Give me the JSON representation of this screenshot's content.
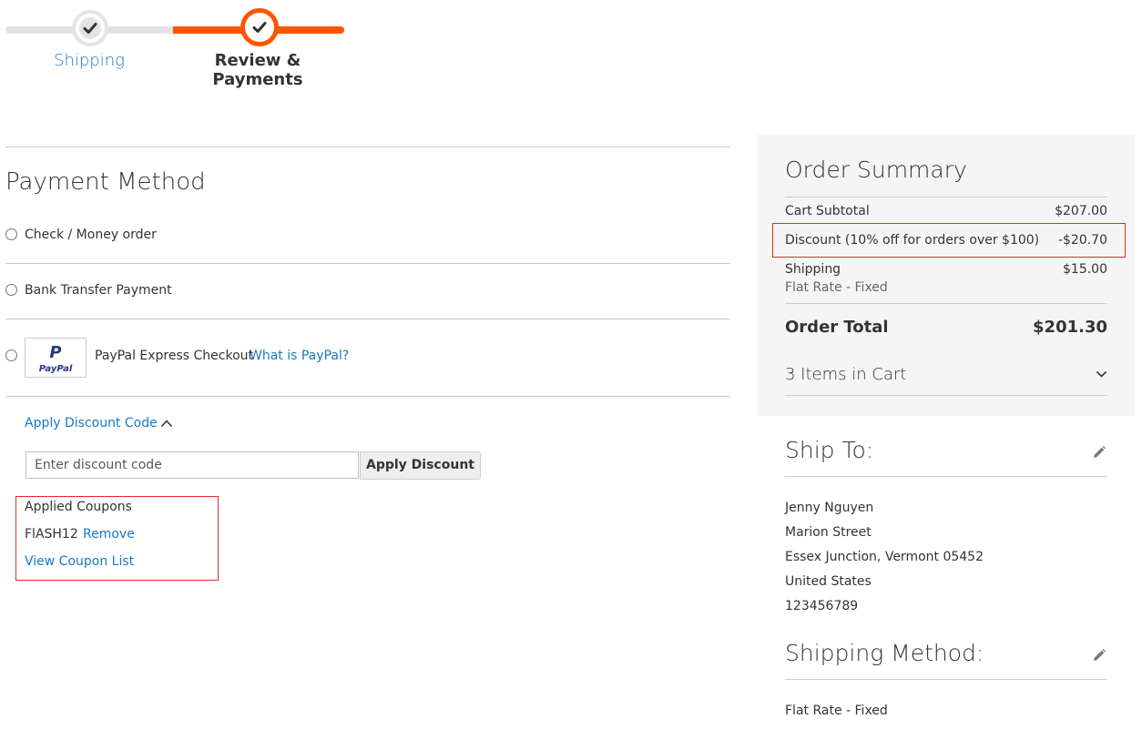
{
  "progress": {
    "steps": [
      {
        "label": "Shipping",
        "state": "complete"
      },
      {
        "label": "Review & Payments",
        "state": "active"
      }
    ],
    "accent_color": "#ff5501",
    "inactive_color": "#e4e4e4"
  },
  "payment": {
    "title": "Payment Method",
    "options": [
      {
        "label": "Check / Money order"
      },
      {
        "label": "Bank Transfer Payment"
      },
      {
        "label": "PayPal Express Checkout",
        "link": "What is PayPal?",
        "logo_text_top": "P",
        "logo_text": "PayPal"
      }
    ]
  },
  "discount": {
    "toggle_label": "Apply Discount Code",
    "input_placeholder": "Enter discount code",
    "apply_label": "Apply Discount",
    "applied_title": "Applied Coupons",
    "coupon_code": "FlASH12",
    "remove_label": "Remove",
    "view_list_label": "View Coupon List"
  },
  "summary": {
    "title": "Order Summary",
    "subtotal_label": "Cart Subtotal",
    "subtotal_value": "$207.00",
    "discount_label": "Discount (10% off for orders over $100)",
    "discount_value": "-$20.70",
    "shipping_label": "Shipping",
    "shipping_value": "$15.00",
    "shipping_method": "Flat Rate - Fixed",
    "total_label": "Order Total",
    "total_value": "$201.30",
    "items_label": "3 Items in Cart"
  },
  "ship_to": {
    "title": "Ship To:",
    "name": "Jenny Nguyen",
    "street": "Marion Street",
    "city_line": "Essex Junction, Vermont 05452",
    "country": "United States",
    "phone": "123456789"
  },
  "shipping_method": {
    "title": "Shipping Method:",
    "value": "Flat Rate - Fixed"
  },
  "colors": {
    "link": "#1979c3",
    "highlight_border": "#e02b27",
    "summary_bg": "#f5f5f5"
  }
}
